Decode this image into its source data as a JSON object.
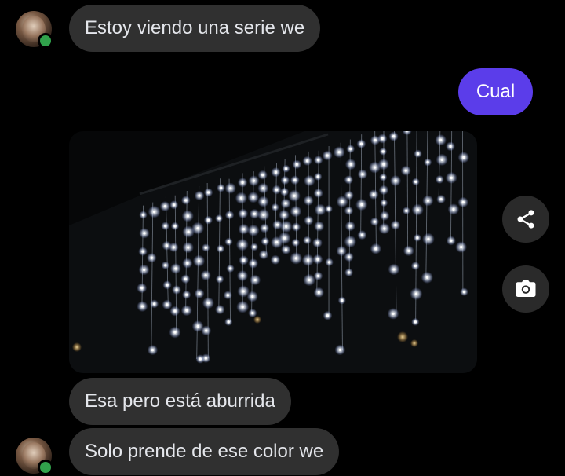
{
  "messages": [
    {
      "direction": "in",
      "text": "Estoy viendo una serie we"
    },
    {
      "direction": "out",
      "text": "Cual"
    },
    {
      "direction": "in",
      "type": "photo"
    },
    {
      "direction": "in",
      "text": "Esa pero está aburrida"
    },
    {
      "direction": "in",
      "text": "Solo prende de ese color we"
    }
  ],
  "contact": {
    "online": true
  },
  "actions": [
    {
      "icon": "share-icon"
    },
    {
      "icon": "camera-icon"
    }
  ],
  "colors": {
    "background": "#000000",
    "incoming_bubble": "#303030",
    "outgoing_bubble": "#5b3dea",
    "online_dot": "#31a24c"
  }
}
